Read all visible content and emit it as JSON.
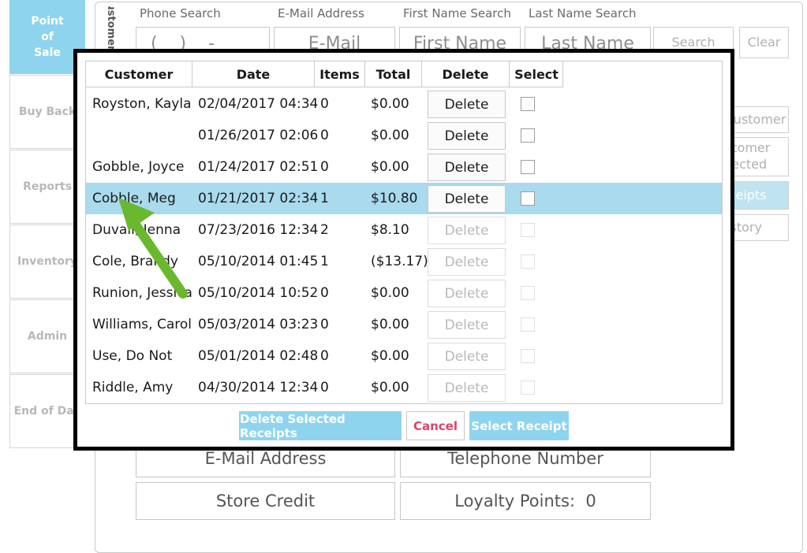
{
  "sidebar": {
    "items": [
      {
        "label": "Point\nof\nSale",
        "active": true
      },
      {
        "label": "Buy Back"
      },
      {
        "label": "Reports"
      },
      {
        "label": "Inventory"
      },
      {
        "label": "Admin"
      },
      {
        "label": "End of Day"
      }
    ]
  },
  "background": {
    "vertical_tab": "Customer",
    "search_labels": [
      "Phone Search",
      "E-Mail Address",
      "First Name Search",
      "Last Name Search"
    ],
    "search_values": [
      "(    )    -",
      "E-Mail",
      "First Name",
      "Last Name"
    ],
    "search_button": "Search",
    "clear_button": "Clear",
    "side_buttons": [
      "New Customer",
      "Customer\nSelected",
      "Receipts",
      "History"
    ],
    "fields": {
      "email": "E-Mail Address",
      "telephone": "Telephone Number",
      "store_credit": "Store Credit",
      "loyalty": "Loyalty Points:  0"
    }
  },
  "modal": {
    "columns": [
      "Customer",
      "Date",
      "Items",
      "Total",
      "Delete",
      "Select"
    ],
    "delete_label": "Delete",
    "rows": [
      {
        "customer": "Royston, Kayla",
        "date": "02/04/2017 04:34",
        "items": "0",
        "total": "$0.00",
        "enabled": true
      },
      {
        "customer": "",
        "date": "01/26/2017 02:06",
        "items": "0",
        "total": "$0.00",
        "enabled": true
      },
      {
        "customer": "Gobble, Joyce",
        "date": "01/24/2017 02:51",
        "items": "0",
        "total": "$0.00",
        "enabled": true
      },
      {
        "customer": "Cobble, Meg",
        "date": "01/21/2017 02:34",
        "items": "1",
        "total": "$10.80",
        "enabled": true,
        "selected": true
      },
      {
        "customer": "Duvall, Jenna",
        "date": "07/23/2016 12:34",
        "items": "2",
        "total": "$8.10",
        "enabled": false
      },
      {
        "customer": "Cole, Brandy",
        "date": "05/10/2014 01:45",
        "items": "1",
        "total": "($13.17)",
        "enabled": false
      },
      {
        "customer": "Runion, Jessica",
        "date": "05/10/2014 10:52",
        "items": "0",
        "total": "$0.00",
        "enabled": false
      },
      {
        "customer": "Williams, Carol",
        "date": "05/03/2014 03:23",
        "items": "0",
        "total": "$0.00",
        "enabled": false
      },
      {
        "customer": "Use, Do Not",
        "date": "05/01/2014 02:48",
        "items": "0",
        "total": "$0.00",
        "enabled": false
      },
      {
        "customer": "Riddle, Amy",
        "date": "04/30/2014 12:34",
        "items": "0",
        "total": "$0.00",
        "enabled": false
      }
    ],
    "buttons": {
      "delete_selected": "Delete Selected Receipts",
      "cancel": "Cancel",
      "select_receipt": "Select Receipt"
    }
  },
  "colors": {
    "accent": "#8fd4ef",
    "selected_row": "#a9daed",
    "cancel_text": "#e0426b",
    "arrow": "#6ab82e"
  },
  "annotation": {
    "icon": "green-arrow-icon"
  }
}
